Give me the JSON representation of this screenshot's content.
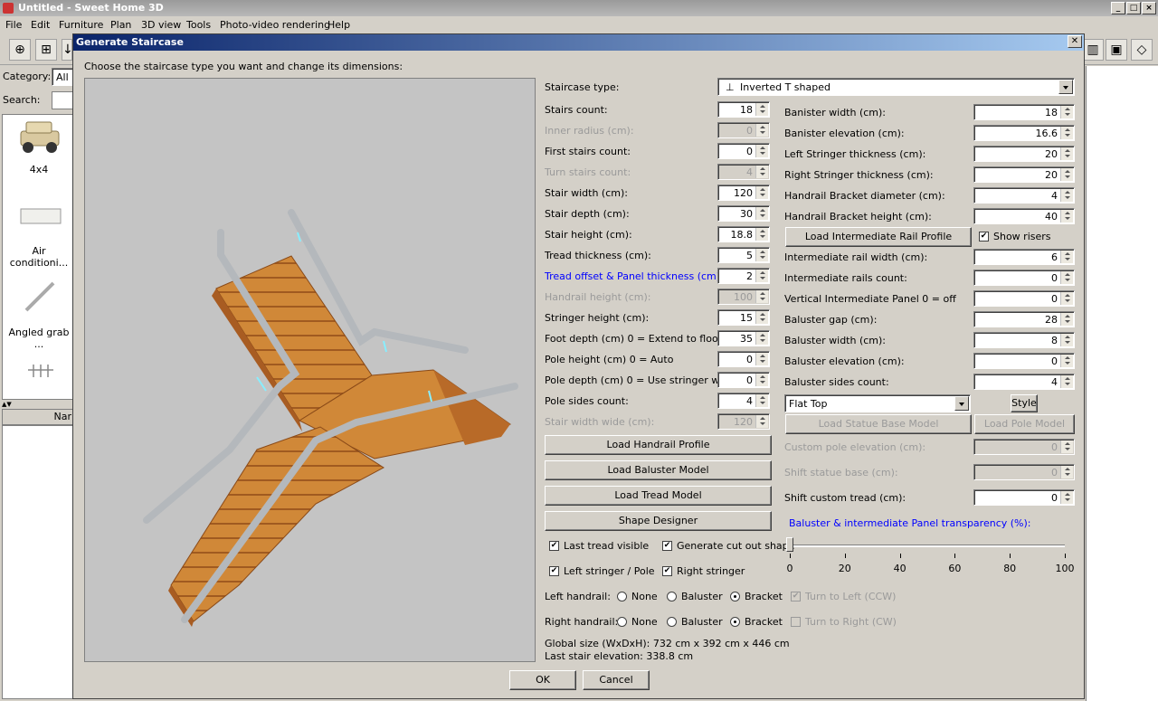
{
  "window": {
    "title": "Untitled - Sweet Home 3D"
  },
  "menu": [
    "File",
    "Edit",
    "Furniture",
    "Plan",
    "3D view",
    "Tools",
    "Photo-video rendering",
    "Help"
  ],
  "catalog": {
    "category_label": "Category:",
    "category_value": "All",
    "search_label": "Search:",
    "items": [
      "4x4",
      "Air conditioni...",
      "Angled grab ..."
    ],
    "column_header": "Nar"
  },
  "dialog": {
    "title": "Generate Staircase",
    "instructions": "Choose the staircase type you want and change its dimensions:",
    "staircase_type": {
      "label": "Staircase type:",
      "value": "Inverted T shaped"
    },
    "left_fields": [
      {
        "label": "Stairs count:",
        "value": "18",
        "enabled": true,
        "blue": false
      },
      {
        "label": "Inner radius (cm):",
        "value": "0",
        "enabled": false,
        "blue": false
      },
      {
        "label": "First stairs count:",
        "value": "0",
        "enabled": true,
        "blue": false
      },
      {
        "label": "Turn stairs count:",
        "value": "4",
        "enabled": false,
        "blue": false
      },
      {
        "label": "Stair width (cm):",
        "value": "120",
        "enabled": true,
        "blue": false
      },
      {
        "label": "Stair depth (cm):",
        "value": "30",
        "enabled": true,
        "blue": false
      },
      {
        "label": "Stair height (cm):",
        "value": "18.8",
        "enabled": true,
        "blue": false
      },
      {
        "label": "Tread thickness (cm):",
        "value": "5",
        "enabled": true,
        "blue": false
      },
      {
        "label": "Tread offset & Panel thickness (cm):",
        "value": "2",
        "enabled": true,
        "blue": true
      },
      {
        "label": "Handrail height (cm):",
        "value": "100",
        "enabled": false,
        "blue": false
      },
      {
        "label": "Stringer height (cm):",
        "value": "15",
        "enabled": true,
        "blue": false
      },
      {
        "label": "Foot depth (cm) 0 = Extend to floor",
        "value": "35",
        "enabled": true,
        "blue": false
      },
      {
        "label": "Pole height (cm) 0 = Auto",
        "value": "0",
        "enabled": true,
        "blue": false
      },
      {
        "label": "Pole depth (cm) 0 = Use stringer width",
        "value": "0",
        "enabled": true,
        "blue": false
      },
      {
        "label": "Pole sides count:",
        "value": "4",
        "enabled": true,
        "blue": false
      },
      {
        "label": "Stair width wide (cm):",
        "value": "120",
        "enabled": false,
        "blue": false
      }
    ],
    "right_fields": [
      {
        "label": "Banister width (cm):",
        "value": "18",
        "enabled": true
      },
      {
        "label": "Banister elevation (cm):",
        "value": "16.6",
        "enabled": true
      },
      {
        "label": "Left Stringer thickness (cm):",
        "value": "20",
        "enabled": true
      },
      {
        "label": "Right Stringer thickness (cm):",
        "value": "20",
        "enabled": true
      },
      {
        "label": "Handrail Bracket diameter (cm):",
        "value": "4",
        "enabled": true
      },
      {
        "label": "Handrail Bracket height (cm):",
        "value": "40",
        "enabled": true
      }
    ],
    "right_fields2": [
      {
        "label": "Intermediate rail width (cm):",
        "value": "6",
        "enabled": true
      },
      {
        "label": "Intermediate rails count:",
        "value": "0",
        "enabled": true
      },
      {
        "label": "Vertical Intermediate Panel  0 = off",
        "value": "0",
        "enabled": true
      },
      {
        "label": "Baluster gap (cm):",
        "value": "28",
        "enabled": true
      },
      {
        "label": "Baluster width (cm):",
        "value": "8",
        "enabled": true
      },
      {
        "label": "Baluster elevation (cm):",
        "value": "0",
        "enabled": true
      },
      {
        "label": "Baluster sides count:",
        "value": "4",
        "enabled": true
      }
    ],
    "right_fields3": [
      {
        "label": "Custom pole elevation (cm):",
        "value": "0",
        "enabled": false
      },
      {
        "label": "Shift statue base (cm):",
        "value": "0",
        "enabled": false
      },
      {
        "label": "Shift custom tread (cm):",
        "value": "0",
        "enabled": true
      }
    ],
    "load_rail_profile": "Load Intermediate Rail Profile",
    "show_risers": "Show risers",
    "top_style": {
      "value": "Flat Top"
    },
    "style_button": "Style",
    "load_statue_base": "Load Statue Base Model",
    "load_pole_model": "Load Pole Model",
    "buttons": [
      "Load Handrail Profile",
      "Load Baluster Model",
      "Load Tread Model",
      "Shape Designer"
    ],
    "checks": {
      "last_tread_visible": "Last tread visible",
      "generate_cut_out": "Generate cut out shape",
      "left_stringer": "Left stringer / Pole",
      "right_stringer": "Right stringer"
    },
    "left_handrail": {
      "label": "Left handrail:",
      "options": [
        "None",
        "Baluster",
        "Bracket"
      ],
      "selected": "Bracket"
    },
    "right_handrail": {
      "label": "Right handrail:",
      "options": [
        "None",
        "Baluster",
        "Bracket"
      ],
      "selected": "Bracket"
    },
    "turn_left": "Turn to Left (CCW)",
    "turn_right": "Turn to Right (CW)",
    "transparency": {
      "label": "Baluster & intermediate Panel transparency (%):",
      "ticks": [
        "0",
        "20",
        "40",
        "60",
        "80",
        "100"
      ],
      "value": 0
    },
    "global_size": "Global size (WxDxH): 732 cm x 392 cm x 446 cm",
    "last_elevation": "Last stair elevation: 338.8 cm",
    "ok": "OK",
    "cancel": "Cancel"
  },
  "colors": {
    "wood": "#c8782e",
    "rail": "#b4b8bc",
    "title_blue": "#0a246a"
  }
}
